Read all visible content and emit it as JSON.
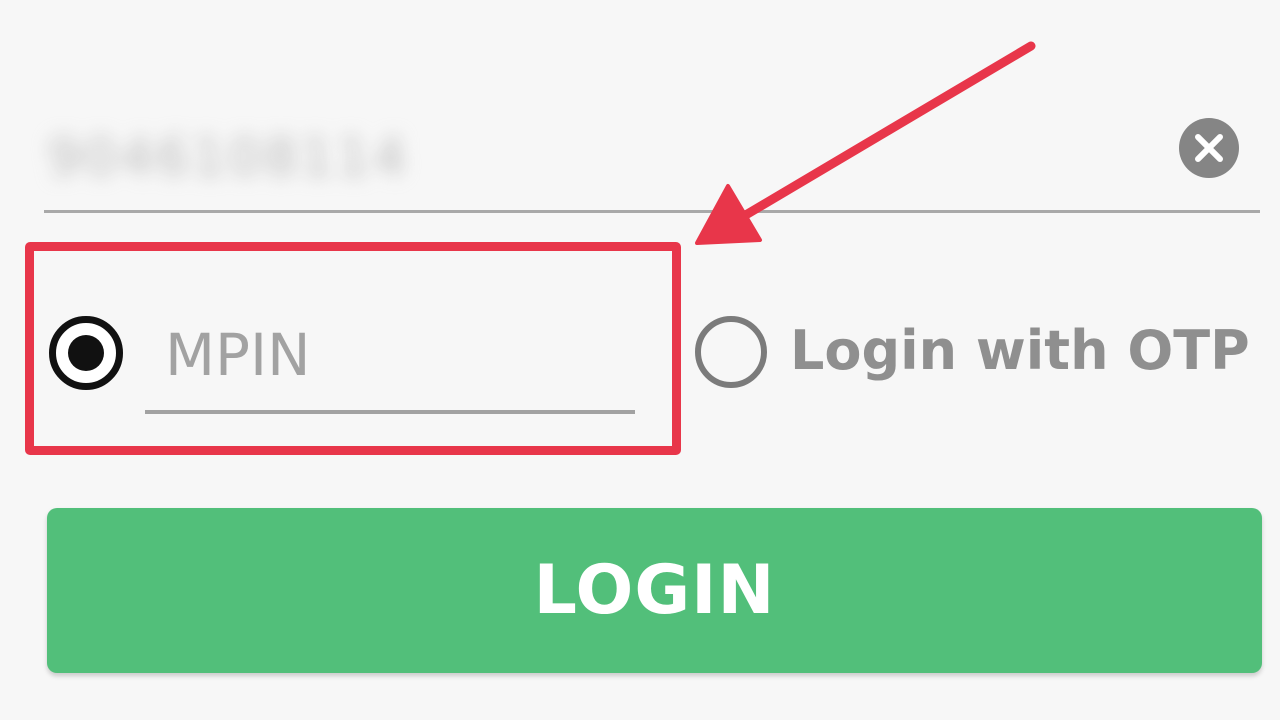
{
  "phone_field": {
    "value": "9046108114",
    "clear_icon": "close-circle-icon"
  },
  "login_mode": {
    "mpin_placeholder": "MPIN",
    "mpin_selected": true,
    "otp_label": "Login with OTP",
    "otp_selected": false
  },
  "login_button": {
    "label": "LOGIN"
  },
  "annotation": {
    "highlight_color": "#e8364a",
    "arrow_icon": "arrow-pointer-icon"
  },
  "colors": {
    "primary_button": "#52bf7a",
    "background": "#f7f7f7"
  }
}
